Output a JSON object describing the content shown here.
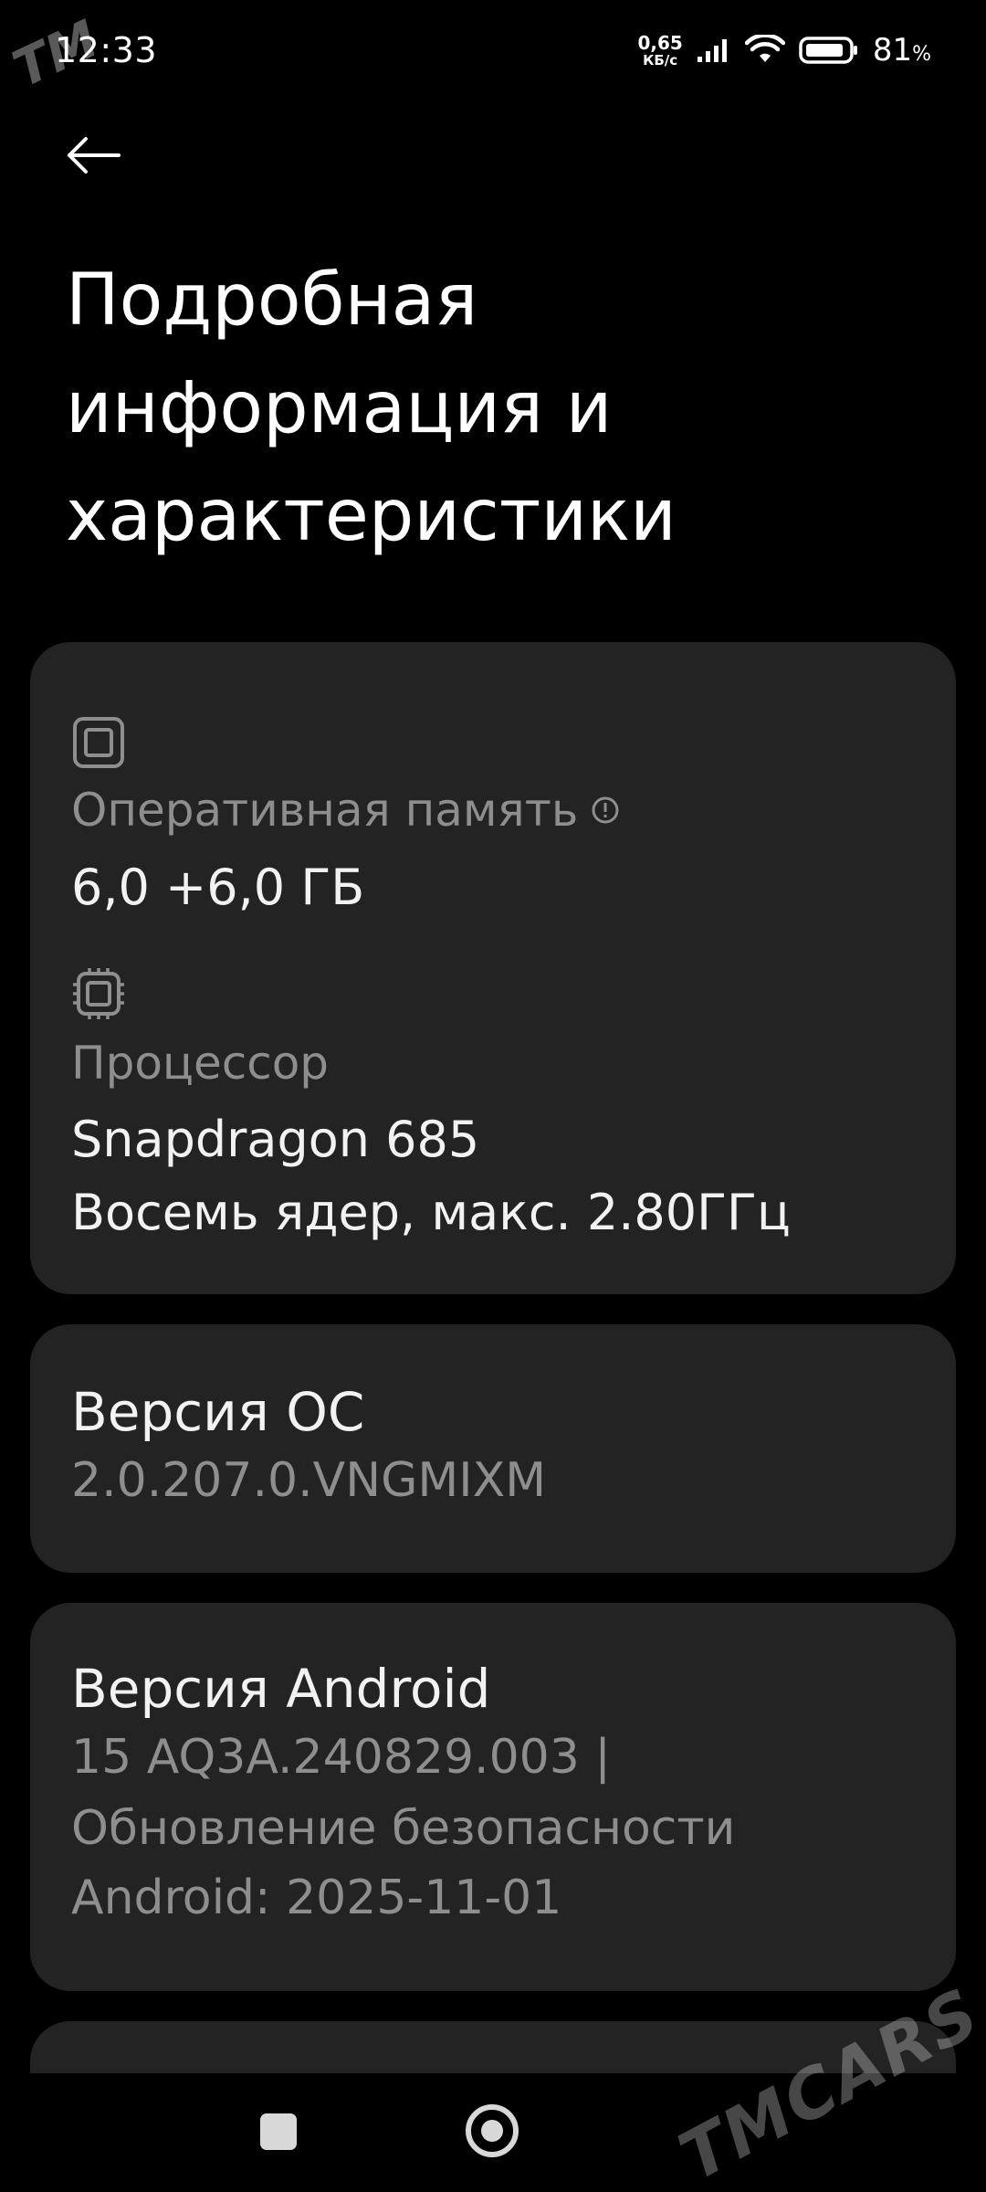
{
  "status_bar": {
    "time": "12:33",
    "net_speed_value": "0,65",
    "net_speed_unit": "КБ/с",
    "battery_percent": "81",
    "battery_percent_sign": "%"
  },
  "header": {
    "back_icon": "arrow-left-icon",
    "title_lines": [
      "Подробная",
      "информация и",
      "характеристики"
    ]
  },
  "hardware_card": {
    "ram": {
      "icon": "memory-chip-icon",
      "label": "Оперативная память",
      "info_icon": "info-circle-icon",
      "value": "6,0 +6,0 ГБ"
    },
    "processor": {
      "icon": "cpu-chip-icon",
      "label": "Процессор",
      "value_line1": "Snapdragon 685",
      "value_line2": "Восемь ядер, макс. 2.80ГГц"
    }
  },
  "os_card": {
    "title": "Версия ОС",
    "value": "2.0.207.0.VNGMIXM"
  },
  "android_card": {
    "title": "Версия Android",
    "value_lines": [
      "15 AQ3A.240829.003 |",
      "Обновление безопасности",
      "Android: 2025-11-01"
    ]
  },
  "nav_bar": {
    "recents_icon": "square-recents-icon",
    "home_icon": "circle-home-icon"
  },
  "watermarks": {
    "top_left": "TM",
    "bottom_right": "TMCARS"
  },
  "colors": {
    "background": "#000000",
    "card": "#232323",
    "primary_text": "#f2f2f2",
    "secondary_text": "#8e8e8e"
  }
}
